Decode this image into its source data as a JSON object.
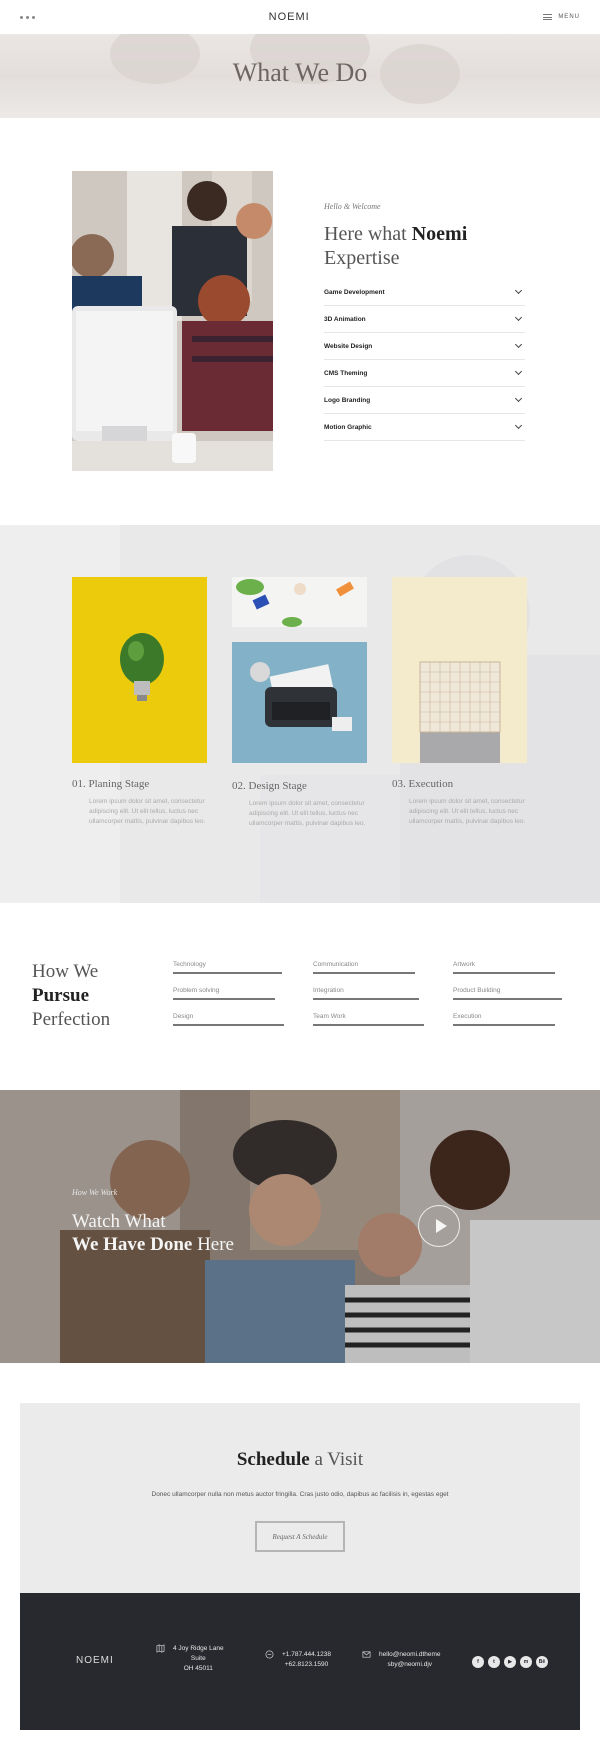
{
  "header": {
    "brand": "NOEMI",
    "menu_label": "MENU"
  },
  "hero": {
    "title": "What We Do"
  },
  "expertise": {
    "eyebrow": "Hello & Welcome",
    "title_part1": "Here what",
    "title_bold": "Noemi",
    "title_part2": "Expertise",
    "items": [
      {
        "label": "Game Development"
      },
      {
        "label": "3D Animation"
      },
      {
        "label": "Website Design"
      },
      {
        "label": "CMS Theming"
      },
      {
        "label": "Logo Branding"
      },
      {
        "label": "Motion Graphic"
      }
    ]
  },
  "stages": [
    {
      "title": "01. Planing Stage",
      "text": "Lorem ipsum dolor sit amet, consectetur adipiscing elit. Ut elit tellus, luctus nec ullamcorper mattis, pulvinar dapibus leo."
    },
    {
      "title": "02. Design Stage",
      "text": "Lorem ipsum dolor sit amet, consectetur adipiscing elit. Ut elit tellus, luctus nec ullamcorper mattis, pulvinar dapibus leo."
    },
    {
      "title": "03. Execution",
      "text": "Lorem ipsum dolor sit amet, consectetur adipiscing elit. Ut elit tellus, luctus nec ullamcorper mattis, pulvinar dapibus leo."
    }
  ],
  "pursue": {
    "title_line1": "How We",
    "title_bold": "Pursue",
    "title_line3": "Perfection",
    "skills": [
      {
        "label": "Technology"
      },
      {
        "label": "Communication"
      },
      {
        "label": "Artwork"
      },
      {
        "label": "Problem solving"
      },
      {
        "label": "Integration"
      },
      {
        "label": "Product Building"
      },
      {
        "label": "Design"
      },
      {
        "label": "Team Work"
      },
      {
        "label": "Execution"
      }
    ]
  },
  "video": {
    "eyebrow": "How We Work",
    "title_line1": "Watch What",
    "title_bold": "We Have Done",
    "title_tail": "Here"
  },
  "schedule": {
    "title_bold": "Schedule",
    "title_rest": "a Visit",
    "text": "Donec ullamcorper nulla non metus auctor fringilla. Cras justo odio, dapibus ac facilisis in, egestas eget",
    "button": "Request A Schedule"
  },
  "footer": {
    "brand": "NOEMI",
    "address_line1": "4 Joy Ridge Lane",
    "address_line2": "Suite",
    "address_line3": "OH 45011",
    "phone1": "+1.787.444.1238",
    "phone2": "+62.8123.1590",
    "email1": "hello@neomi.dtheme",
    "email2": "sby@neomi.djv",
    "socials": [
      "facebook-icon",
      "twitter-icon",
      "youtube-icon",
      "messenger-icon",
      "behance-icon"
    ],
    "social_glyphs": [
      "f",
      "t",
      "▶",
      "m",
      "Bē"
    ]
  },
  "colors": {
    "footer_bg": "#28292e",
    "yellow_card": "#ecca0c",
    "blue_card": "#82b1c8",
    "cream_card": "#f3ebcb"
  }
}
